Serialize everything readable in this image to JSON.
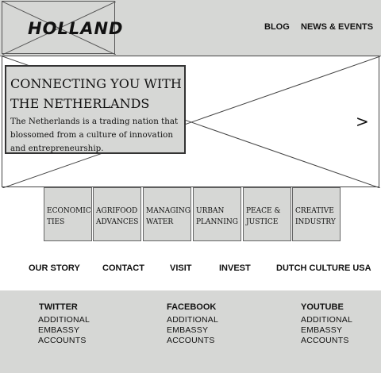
{
  "header": {
    "logo": "HOLLAND",
    "nav": [
      "BLOG",
      "NEWS & EVENTS"
    ]
  },
  "hero": {
    "title_line1": "CONNECTING YOU WITH",
    "title_line2": "THE NETHERLANDS",
    "text_line1": "The Netherlands is a trading nation that",
    "text_line2": "blossomed from a culture of innovation",
    "text_line3": "and entrepreneurship.",
    "next_arrow": ">"
  },
  "tiles": [
    {
      "line1": "ECONOMIC",
      "line2": "TIES"
    },
    {
      "line1": "AGRIFOOD",
      "line2": "ADVANCES"
    },
    {
      "line1": "MANAGING",
      "line2": "WATER"
    },
    {
      "line1": "URBAN",
      "line2": "PLANNING"
    },
    {
      "line1": "PEACE &",
      "line2": "JUSTICE"
    },
    {
      "line1": "CREATIVE",
      "line2": "INDUSTRY"
    }
  ],
  "main_nav": [
    "OUR STORY",
    "CONTACT",
    "VISIT",
    "INVEST",
    "DUTCH CULTURE USA"
  ],
  "footer": {
    "columns": [
      {
        "heading": "TWITTER",
        "link1": "ADDITIONAL",
        "link2": "EMBASSY",
        "link3": "ACCOUNTS"
      },
      {
        "heading": "FACEBOOK",
        "link1": "ADDITIONAL",
        "link2": "EMBASSY",
        "link3": "ACCOUNTS"
      },
      {
        "heading": "YOUTUBE",
        "link1": "ADDITIONAL",
        "link2": "EMBASSY",
        "link3": "ACCOUNTS"
      }
    ]
  },
  "colors": {
    "panel_gray": "#d6d7d5",
    "line": "#444444"
  }
}
